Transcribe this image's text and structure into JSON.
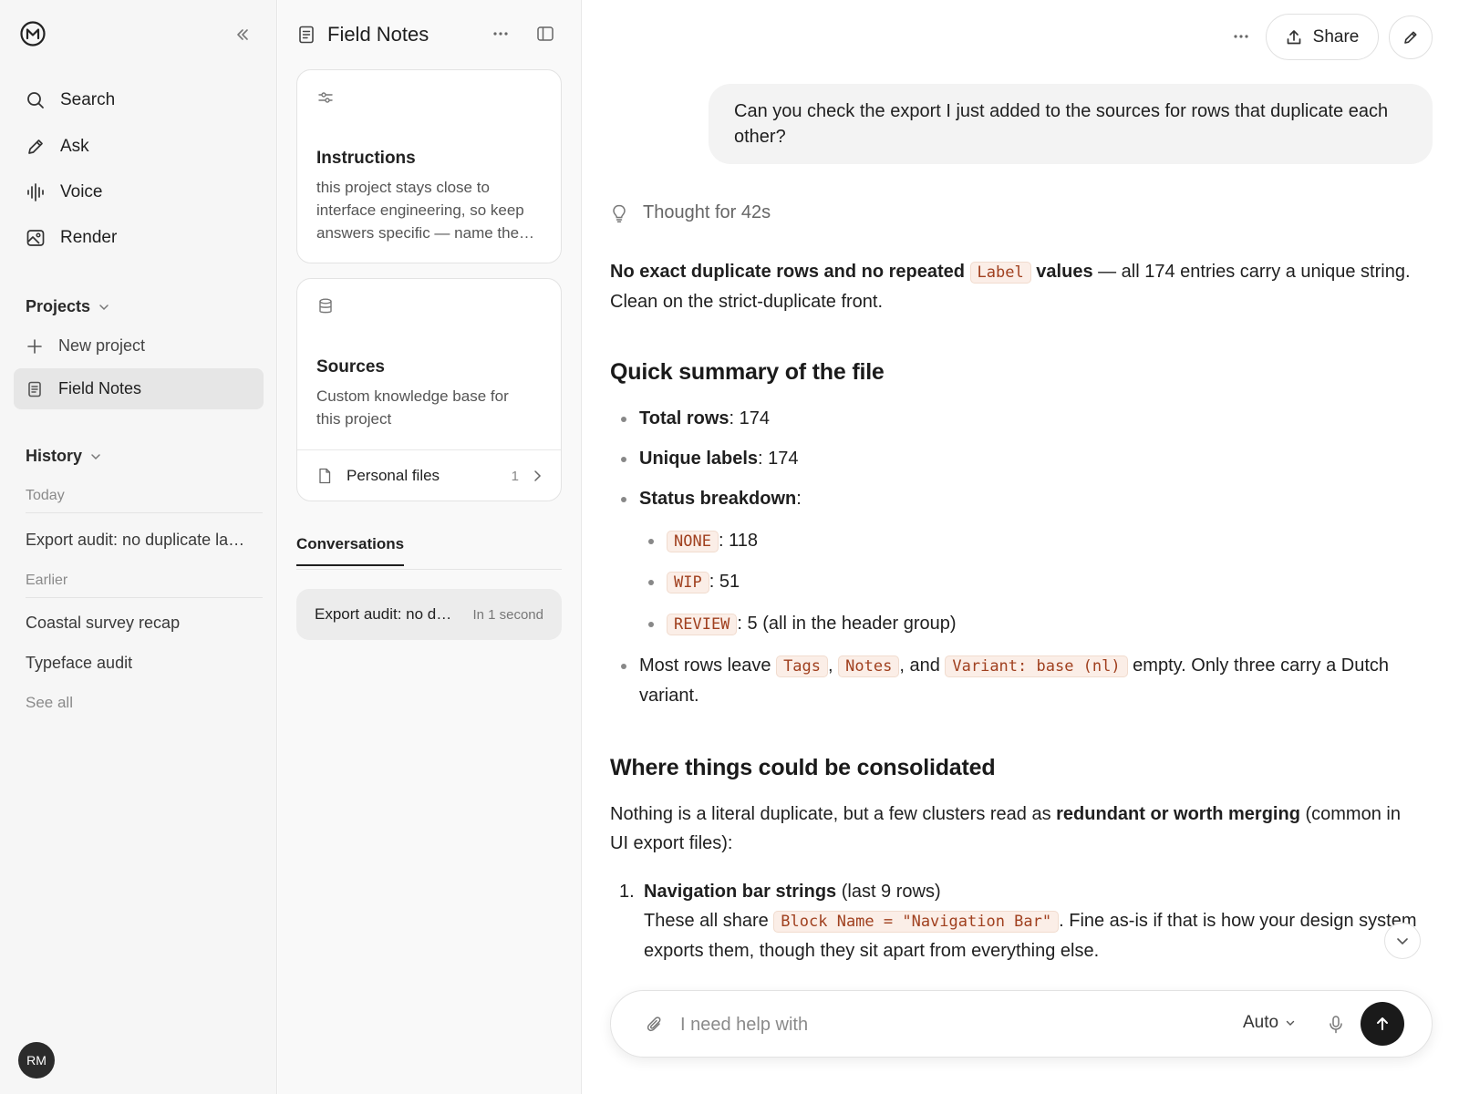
{
  "sidebar": {
    "logo_icon": "brand-logo-m",
    "nav": [
      {
        "label": "Search",
        "icon": "search-icon"
      },
      {
        "label": "Ask",
        "icon": "pencil-icon"
      },
      {
        "label": "Voice",
        "icon": "waveform-icon"
      },
      {
        "label": "Render",
        "icon": "image-icon"
      }
    ],
    "projects_heading": "Projects",
    "new_project_label": "New project",
    "active_project_label": "Field Notes",
    "history_heading": "History",
    "today_label": "Today",
    "today_items": [
      "Export audit: no duplicate labels"
    ],
    "earlier_label": "Earlier",
    "earlier_items": [
      "Coastal survey recap",
      "Typeface audit"
    ],
    "see_all_label": "See all",
    "avatar_initials": "RM"
  },
  "project": {
    "title": "Field Notes",
    "instructions": {
      "title": "Instructions",
      "body": "this project stays close to interface engineering, so keep answers specific — name the…"
    },
    "sources": {
      "title": "Sources",
      "body": "Custom knowledge base for this project",
      "personal_files_label": "Personal files",
      "personal_files_count": "1"
    },
    "conversations_tab": "Conversations",
    "conversation": {
      "title": "Export audit: no duplicate labels",
      "time": "In 1 second"
    }
  },
  "chat": {
    "share_label": "Share",
    "user_message": "Can you check the export I just added to the sources for rows that duplicate each other?",
    "thought_label": "Thought for 42s",
    "answer": {
      "intro_bold_1": "No exact duplicate rows and no repeated",
      "intro_code": "Label",
      "intro_bold_2": "values",
      "intro_rest": " — all 174 entries carry a unique string. Clean on the strict-duplicate front.",
      "h_summary": "Quick summary of the file",
      "total_rows_label": "Total rows",
      "total_rows_value": ": 174",
      "unique_labels_label": "Unique labels",
      "unique_labels_value": ": 174",
      "status_label": "Status breakdown",
      "status_colon": ":",
      "status": [
        {
          "code": "NONE",
          "text": ": 118"
        },
        {
          "code": "WIP",
          "text": ": 51"
        },
        {
          "code": "REVIEW",
          "text": ": 5 (all in the header group)"
        }
      ],
      "most_rows_pre": "Most rows leave ",
      "code_tags": "Tags",
      "sep_comma": ", ",
      "code_notes": "Notes",
      "sep_and": ", and ",
      "code_variant": "Variant: base (nl)",
      "most_rows_post": " empty. Only three carry a Dutch variant.",
      "h_consolidate": "Where things could be consolidated",
      "consolidate_pre": "Nothing is a literal duplicate, but a few clusters read as ",
      "consolidate_bold": "redundant or worth merging",
      "consolidate_post": " (common in UI export files):",
      "item1_num": "1.",
      "item1_title": "Navigation bar strings",
      "item1_title_rest": " (last 9 rows)",
      "item1_pre": "These all share ",
      "item1_code": "Block Name = \"Navigation Bar\"",
      "item1_post": ". Fine as-is if that is how your design system exports them, though they sit apart from everything else."
    },
    "composer": {
      "placeholder": "I need help with",
      "mode_label": "Auto"
    }
  }
}
